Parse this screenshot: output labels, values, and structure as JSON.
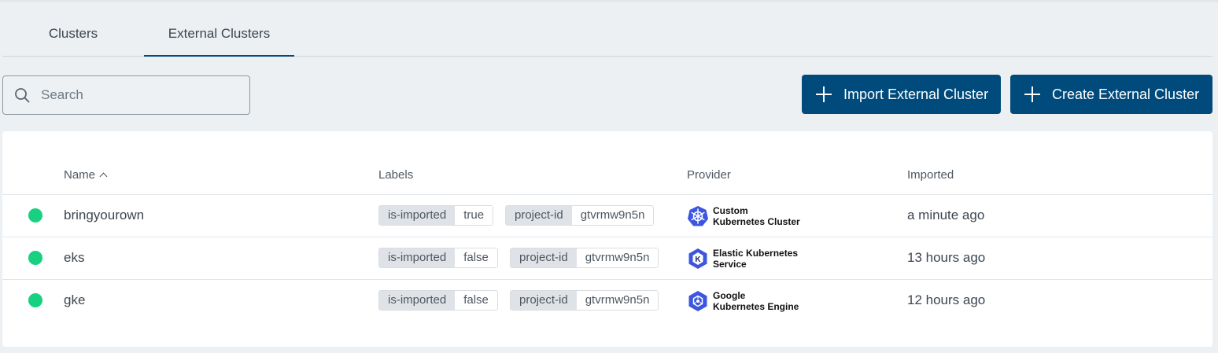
{
  "tabs": [
    {
      "label": "Clusters",
      "active": false
    },
    {
      "label": "External Clusters",
      "active": true
    }
  ],
  "search": {
    "placeholder": "Search",
    "value": ""
  },
  "actions": {
    "import_label": "Import External Cluster",
    "create_label": "Create External Cluster"
  },
  "table": {
    "columns": {
      "name": "Name",
      "labels": "Labels",
      "provider": "Provider",
      "imported": "Imported"
    },
    "sort": {
      "column": "Name",
      "direction": "ascending"
    },
    "rows": [
      {
        "status": "ready",
        "name": "bringyourown",
        "labels": [
          {
            "key": "is-imported",
            "value": "true"
          },
          {
            "key": "project-id",
            "value": "gtvrmw9n5n"
          }
        ],
        "provider": {
          "icon": "kubernetes-icon",
          "line1": "Custom",
          "line2": "Kubernetes Cluster"
        },
        "imported": "a minute ago"
      },
      {
        "status": "ready",
        "name": "eks",
        "labels": [
          {
            "key": "is-imported",
            "value": "false"
          },
          {
            "key": "project-id",
            "value": "gtvrmw9n5n"
          }
        ],
        "provider": {
          "icon": "eks-icon",
          "line1": "Elastic Kubernetes",
          "line2": "Service"
        },
        "imported": "13 hours ago"
      },
      {
        "status": "ready",
        "name": "gke",
        "labels": [
          {
            "key": "is-imported",
            "value": "false"
          },
          {
            "key": "project-id",
            "value": "gtvrmw9n5n"
          }
        ],
        "provider": {
          "icon": "gke-icon",
          "line1": "Google",
          "line2": "Kubernetes Engine"
        },
        "imported": "12 hours ago"
      }
    ]
  },
  "colors": {
    "primary": "#004b7c",
    "status_ready": "#17d181",
    "provider_icon": "#3c56e0",
    "background": "#edf0f2"
  }
}
